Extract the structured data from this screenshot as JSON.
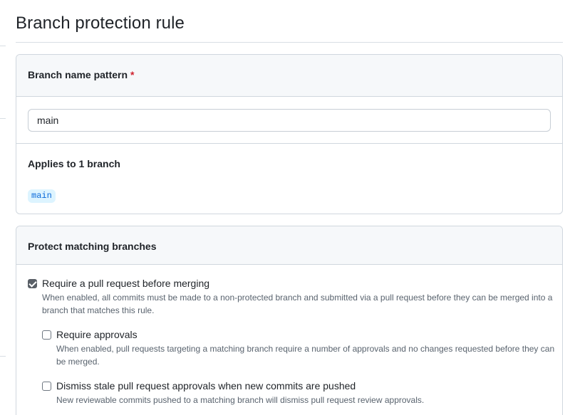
{
  "page": {
    "title": "Branch protection rule"
  },
  "pattern_section": {
    "label": "Branch name pattern",
    "required_marker": "*",
    "input_value": "main",
    "applies_label": "Applies to 1 branch",
    "matched_branches": [
      "main"
    ]
  },
  "protect_section": {
    "header": "Protect matching branches",
    "options": [
      {
        "label": "Require a pull request before merging",
        "description": "When enabled, all commits must be made to a non-protected branch and submitted via a pull request before they can be merged into a branch that matches this rule.",
        "checked": true
      },
      {
        "label": "Require approvals",
        "description": "When enabled, pull requests targeting a matching branch require a number of approvals and no changes requested before they can be merged.",
        "checked": false
      },
      {
        "label": "Dismiss stale pull request approvals when new commits are pushed",
        "description": "New reviewable commits pushed to a matching branch will dismiss pull request review approvals.",
        "checked": false
      }
    ]
  },
  "colors": {
    "required": "#cf222e",
    "branch_chip_bg": "#ddf4ff",
    "branch_chip_text": "#0969da",
    "header_bg": "#f6f8fa",
    "border": "#d0d7de"
  }
}
